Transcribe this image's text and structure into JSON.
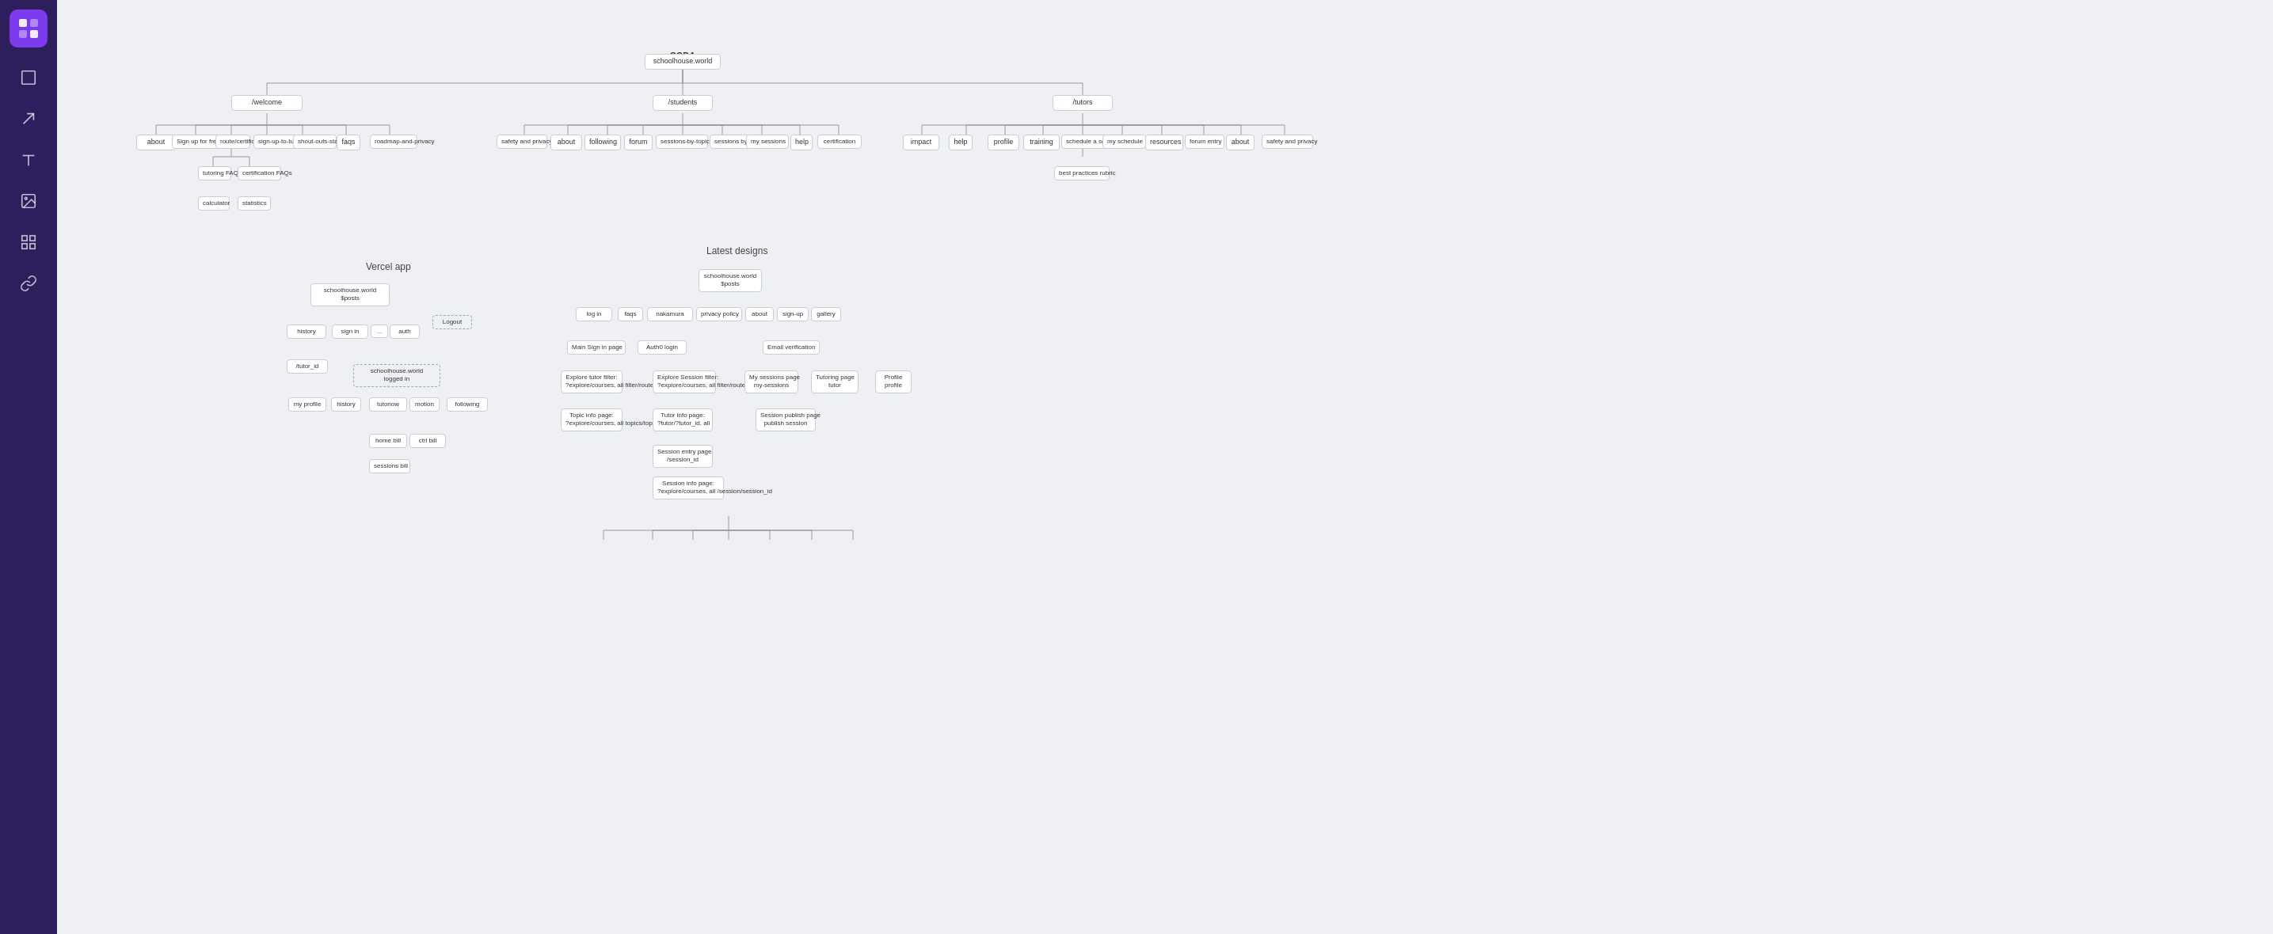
{
  "sidebar": {
    "logo_alt": "App Logo",
    "tools": [
      {
        "name": "frame-tool",
        "label": "Frame"
      },
      {
        "name": "arrow-tool",
        "label": "Arrow"
      },
      {
        "name": "text-tool",
        "label": "Text"
      },
      {
        "name": "image-tool",
        "label": "Image"
      },
      {
        "name": "grid-tool",
        "label": "Grid"
      },
      {
        "name": "link-tool",
        "label": "Link"
      }
    ]
  },
  "diagrams": {
    "coda": {
      "title": "CODA",
      "root": "schoolhouse.world",
      "sections": [
        {
          "name": "/welcome",
          "children": [
            "about",
            "Sign up for free tutoring",
            "route/certification",
            "sign-up-to-tutor",
            "shout-outs-stand",
            "faqs",
            "roadmap-and-privacy"
          ]
        },
        {
          "name": "/students",
          "children": [
            "safety and privacy",
            "about",
            "following",
            "forum",
            "sessions-by-topic",
            "sessions by tutor",
            "my sessions",
            "help",
            "certification"
          ]
        },
        {
          "name": "/tutors",
          "children": [
            "impact",
            "help",
            "profile",
            "training",
            "schedule a session",
            "my schedule",
            "resources",
            "forum entry",
            "about",
            "safety and privacy"
          ]
        }
      ]
    },
    "vercel": {
      "title": "Vercel app"
    },
    "latest": {
      "title": "Latest designs"
    }
  }
}
